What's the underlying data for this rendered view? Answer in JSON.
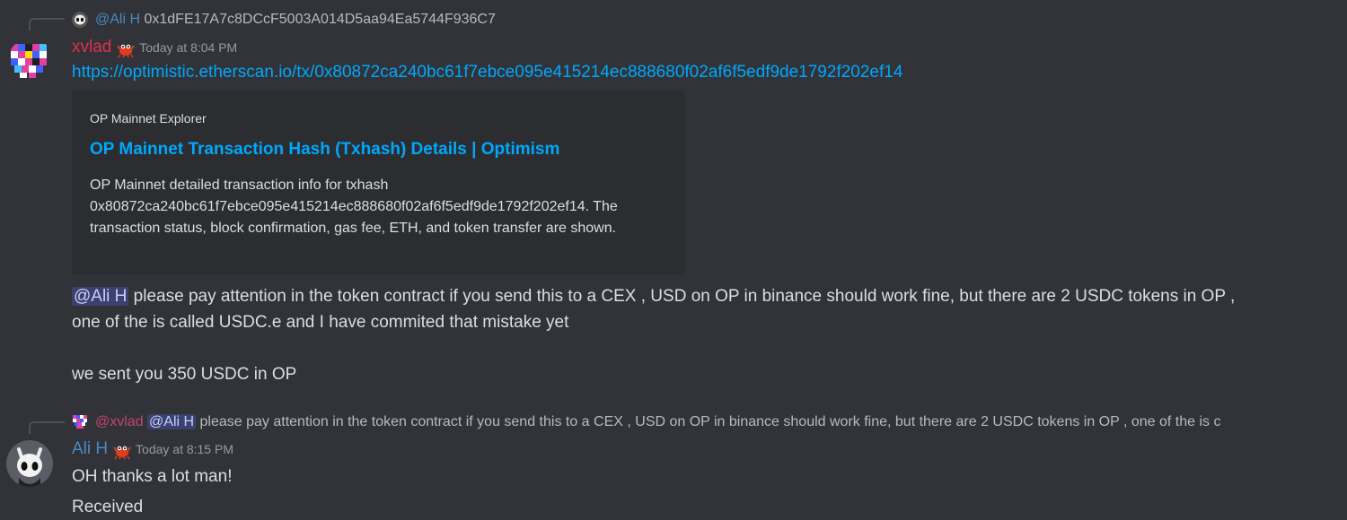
{
  "message1": {
    "reply": {
      "author": "@Ali H",
      "text": "0x1dFE17A7c8DCcF5003A014D5aa94Ea5744F936C7"
    },
    "author": "xvlad",
    "timestamp": "Today at 8:04 PM",
    "link": "https://optimistic.etherscan.io/tx/0x80872ca240bc61f7ebce095e415214ec888680f02af6f5edf9de1792f202ef14",
    "embed": {
      "provider": "OP Mainnet Explorer",
      "title": "OP Mainnet Transaction Hash (Txhash) Details | Optimism",
      "description": "OP Mainnet detailed transaction info for txhash 0x80872ca240bc61f7ebce095e415214ec888680f02af6f5edf9de1792f202ef14. The transaction status, block confirmation, gas fee, ETH, and token transfer are shown."
    },
    "mention": "@Ali H",
    "text_line1": " please pay attention in the token contract if you send this to a CEX , USD on OP in binance should work fine, but there are 2 USDC tokens in OP ,",
    "text_line2": "one of the is called USDC.e and I have commited that mistake yet",
    "text_line3": "we sent you 350 USDC in OP"
  },
  "message2": {
    "reply": {
      "author": "@xvlad",
      "mention": "@Ali H",
      "text": " please pay attention in the token contract if you send this to a CEX , USD on OP in binance should work fine, but there are 2 USDC tokens in OP , one of the is c"
    },
    "author": "Ali H",
    "timestamp": "Today at 8:15 PM",
    "line1": "OH thanks a lot man!",
    "line2": "Received"
  },
  "colors": {
    "background": "#313338",
    "embed_bg": "#2b2d31",
    "link": "#00a8fc",
    "xvlad_name": "#e0304e",
    "ali_name": "#4a8ac2",
    "mention_bg": "#3c4270"
  },
  "icons": [
    "ghost-avatar",
    "pixel-avatar",
    "red-crab-badge"
  ]
}
